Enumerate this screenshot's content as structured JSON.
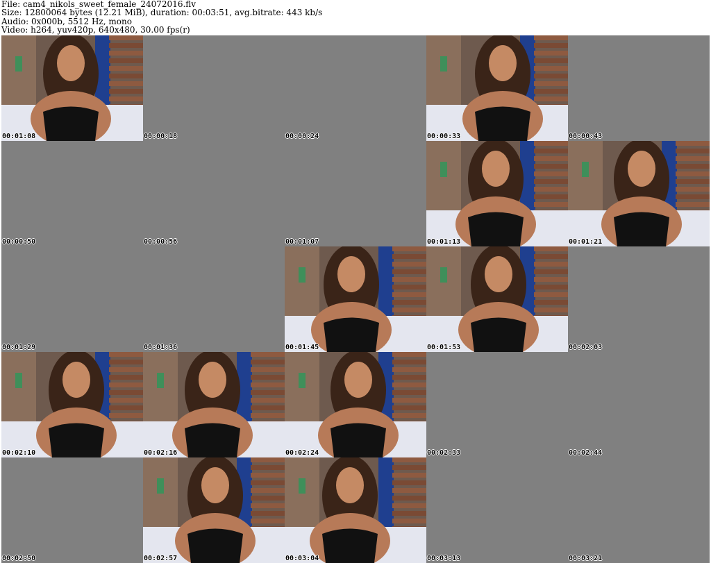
{
  "header": {
    "file_line": "File: cam4_nikols_sweet_female_24072016.flv",
    "size_line": "Size: 12800064 bytes (12.21 MiB), duration: 00:03:51, avg.bitrate: 443 kb/s",
    "audio_line": "Audio: 0x000b, 5512 Hz, mono",
    "video_line": "Video: h264, yuv420p, 640x480, 30.00 fps(r)"
  },
  "colors": {
    "background": "#ffffff",
    "empty_frame": "#808080",
    "timestamp_text": "#000000",
    "timestamp_outline": "#ffffff"
  },
  "thumbnails": [
    {
      "time": "00:01:08",
      "has_frame": true
    },
    {
      "time": "00:00:18",
      "has_frame": false
    },
    {
      "time": "00:00:24",
      "has_frame": false
    },
    {
      "time": "00:00:33",
      "has_frame": true
    },
    {
      "time": "00:00:43",
      "has_frame": false
    },
    {
      "time": "00:00:50",
      "has_frame": false
    },
    {
      "time": "00:00:56",
      "has_frame": false
    },
    {
      "time": "00:01:07",
      "has_frame": false
    },
    {
      "time": "00:01:13",
      "has_frame": true
    },
    {
      "time": "00:01:21",
      "has_frame": true
    },
    {
      "time": "00:01:29",
      "has_frame": false
    },
    {
      "time": "00:01:36",
      "has_frame": false
    },
    {
      "time": "00:01:45",
      "has_frame": true
    },
    {
      "time": "00:01:53",
      "has_frame": true
    },
    {
      "time": "00:02:03",
      "has_frame": false
    },
    {
      "time": "00:02:10",
      "has_frame": true
    },
    {
      "time": "00:02:16",
      "has_frame": true
    },
    {
      "time": "00:02:24",
      "has_frame": true
    },
    {
      "time": "00:02:33",
      "has_frame": false
    },
    {
      "time": "00:02:44",
      "has_frame": false
    },
    {
      "time": "00:02:50",
      "has_frame": false
    },
    {
      "time": "00:02:57",
      "has_frame": true
    },
    {
      "time": "00:03:04",
      "has_frame": true
    },
    {
      "time": "00:03:13",
      "has_frame": false
    },
    {
      "time": "00:03:21",
      "has_frame": false
    }
  ]
}
